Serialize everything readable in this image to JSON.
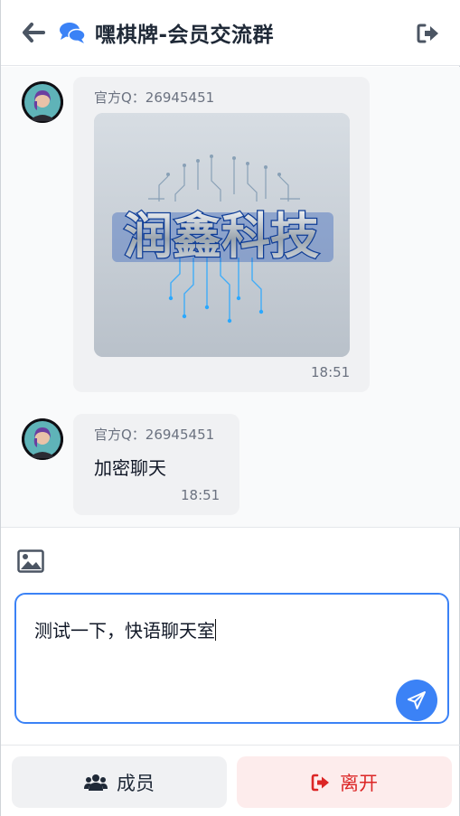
{
  "header": {
    "title": "嘿棋牌-会员交流群",
    "back_icon": "arrow-left-icon",
    "chat_icon": "comments-icon",
    "exit_icon": "sign-out-icon"
  },
  "messages": [
    {
      "sender": "官方Q：26945451",
      "type": "image",
      "image_caption": "润鑫科技",
      "time": "18:51"
    },
    {
      "sender": "官方Q：26945451",
      "type": "text",
      "text": "加密聊天",
      "time": "18:51"
    }
  ],
  "composer": {
    "image_icon": "image-icon",
    "value": "测试一下，快语聊天室",
    "send_icon": "paper-plane-icon"
  },
  "footer": {
    "members_label": "成员",
    "leave_label": "离开"
  },
  "colors": {
    "accent": "#3b82f6",
    "danger": "#dc2626",
    "danger_bg": "#fdecec"
  }
}
